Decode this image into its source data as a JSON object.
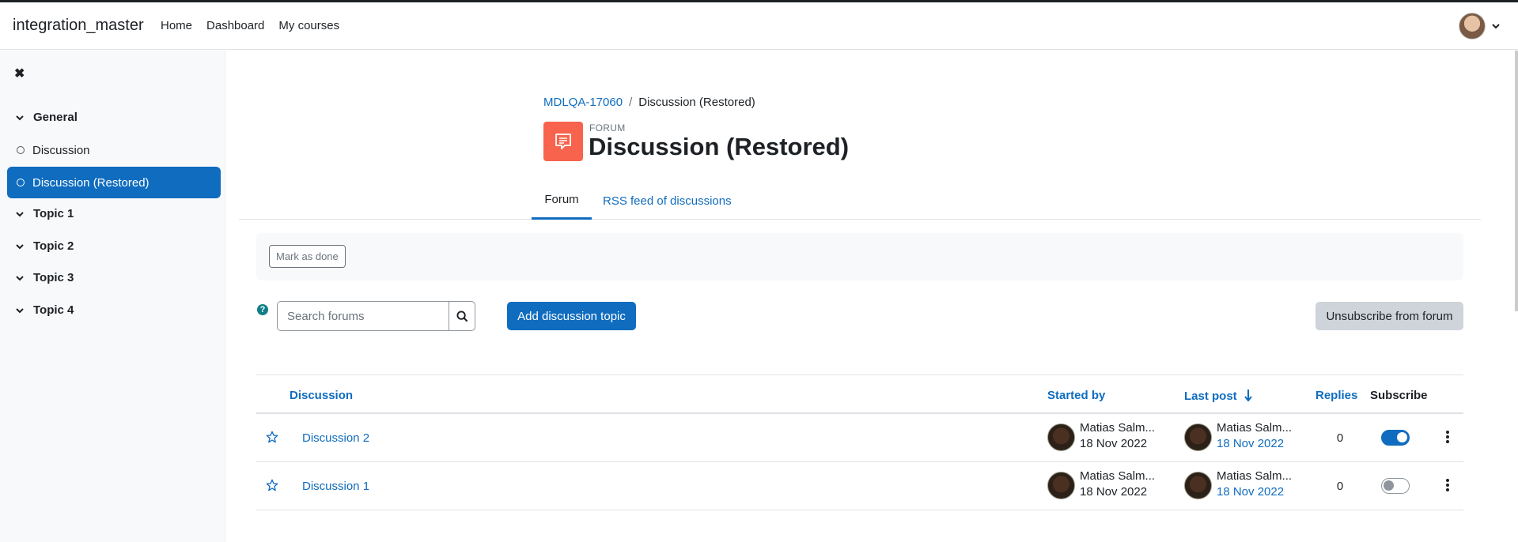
{
  "navbar": {
    "site_name": "integration_master",
    "links": [
      "Home",
      "Dashboard",
      "My courses"
    ]
  },
  "drawer": {
    "sections": [
      {
        "label": "General",
        "activities": [
          "Discussion",
          "Discussion (Restored)"
        ]
      },
      {
        "label": "Topic 1"
      },
      {
        "label": "Topic 2"
      },
      {
        "label": "Topic 3"
      },
      {
        "label": "Topic 4"
      }
    ],
    "selected_activity": "Discussion (Restored)"
  },
  "breadcrumb": {
    "course": "MDLQA-17060",
    "separator": "/",
    "current": "Discussion (Restored)"
  },
  "header": {
    "module_type": "FORUM",
    "title": "Discussion (Restored)",
    "icon_color": "#f7634d"
  },
  "tabs": [
    {
      "label": "Forum"
    },
    {
      "label": "RSS feed of discussions"
    }
  ],
  "completion": {
    "mark_done_label": "Mark as done"
  },
  "toolbar": {
    "search_placeholder": "Search forums",
    "add_label": "Add discussion topic",
    "unsubscribe_label": "Unsubscribe from forum"
  },
  "table": {
    "headers": {
      "discussion": "Discussion",
      "started_by": "Started by",
      "last_post": "Last post",
      "replies": "Replies",
      "subscribe": "Subscribe"
    },
    "sort": "Last post descending",
    "rows": [
      {
        "title": "Discussion 2",
        "started_name": "Matias Salm...",
        "started_date": "18 Nov 2022",
        "last_name": "Matias Salm...",
        "last_date": "18 Nov 2022",
        "replies": "0",
        "subscribed": true
      },
      {
        "title": "Discussion 1",
        "started_name": "Matias Salm...",
        "started_date": "18 Nov 2022",
        "last_name": "Matias Salm...",
        "last_date": "18 Nov 2022",
        "replies": "0",
        "subscribed": false
      }
    ]
  },
  "colors": {
    "primary": "#0f6cbf",
    "secondary_btn": "#ced4da",
    "drawer_bg": "#f8f9fa"
  }
}
